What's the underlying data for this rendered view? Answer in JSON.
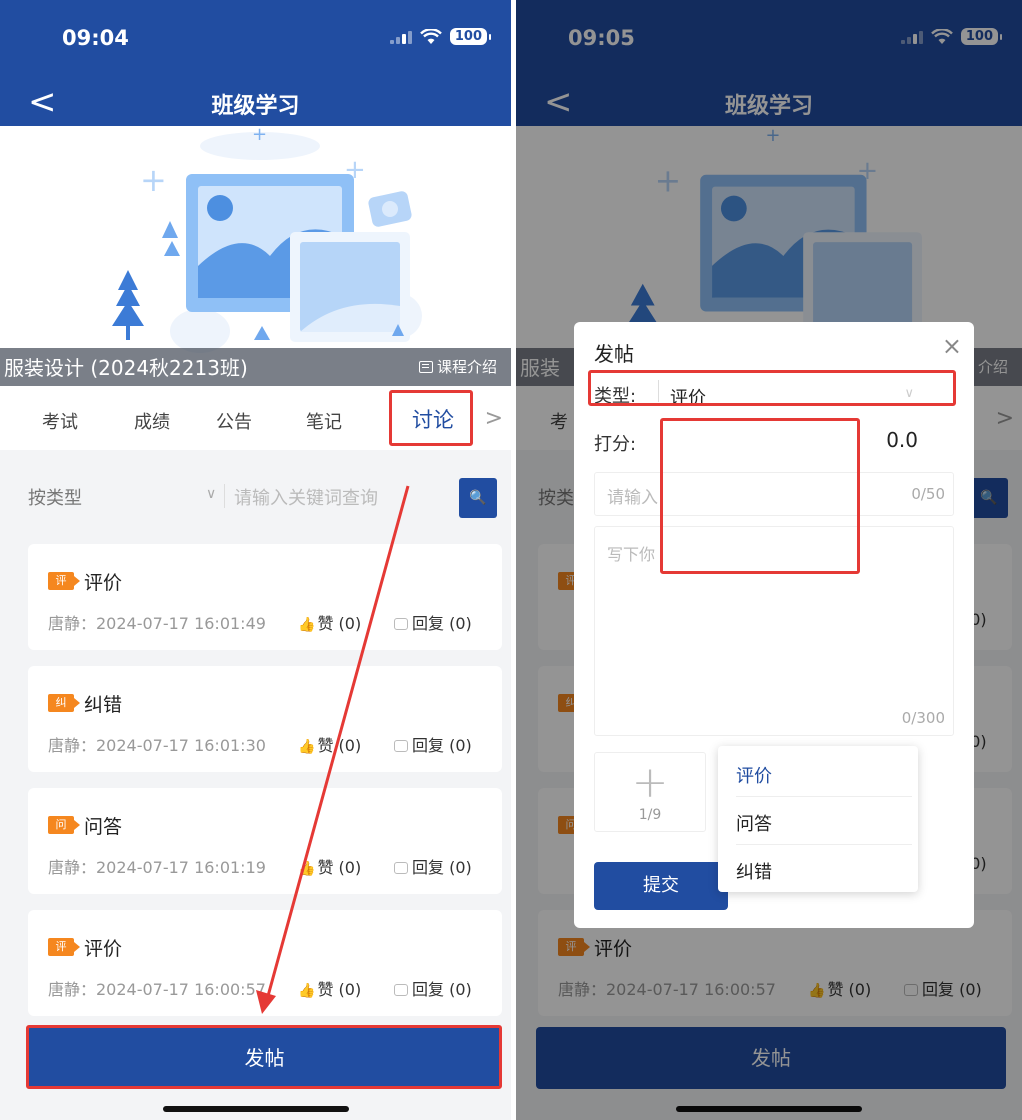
{
  "status_left": {
    "time": "09:04",
    "battery": "100"
  },
  "status_right": {
    "time": "09:05",
    "battery": "100"
  },
  "nav": {
    "back": "<",
    "title": "班级学习"
  },
  "course": {
    "name": "服装设计 (2024秋2213班)",
    "intro": "课程介绍"
  },
  "tabs": {
    "exam": "考试",
    "grade": "成绩",
    "notice": "公告",
    "notes": "笔记",
    "discuss": "讨论",
    "more": ">"
  },
  "filter": {
    "type": "按类型",
    "keyword_placeholder": "请输入关键词查询"
  },
  "posts": [
    {
      "badge": "评",
      "title": "评价",
      "meta": "唐静：2024-07-17 16:01:49",
      "like": "赞 (0)",
      "reply": "回复 (0)"
    },
    {
      "badge": "纠",
      "title": "纠错",
      "meta": "唐静：2024-07-17 16:01:30",
      "like": "赞 (0)",
      "reply": "回复 (0)"
    },
    {
      "badge": "问",
      "title": "问答",
      "meta": "唐静：2024-07-17 16:01:19",
      "like": "赞 (0)",
      "reply": "回复 (0)"
    },
    {
      "badge": "评",
      "title": "评价",
      "meta": "唐静：2024-07-17 16:00:57",
      "like": "赞 (0)",
      "reply": "回复 (0)"
    }
  ],
  "post_button": "发帖",
  "dialog": {
    "title": "发帖",
    "close": "×",
    "type_label": "类型:",
    "type_value": "评价",
    "score_label": "打分:",
    "score_value": "0.0",
    "title_placeholder": "请输入",
    "title_count": "0/50",
    "content_placeholder": "写下你",
    "content_count": "0/300",
    "upload_count": "1/9",
    "submit": "提交"
  },
  "dropdown": {
    "options": [
      "评价",
      "问答",
      "纠错"
    ],
    "selected": "评价"
  },
  "right_partial": {
    "course_prefix": "服装",
    "intro_suffix": "介绍",
    "tab_prefix": "考",
    "filter_prefix": "按类",
    "reply_tail": "(0)",
    "post_meta_prefix": "唐"
  },
  "colors": {
    "brand": "#214da1",
    "badge": "#f5871f",
    "highlight": "#e53935"
  }
}
